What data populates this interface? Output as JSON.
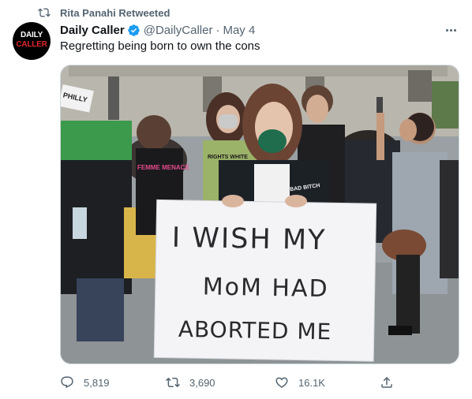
{
  "social_context": {
    "text": "Rita Panahi Retweeted",
    "icon": "retweet-icon"
  },
  "author": {
    "avatar_line1": "DAILY",
    "avatar_line2": "CALLER",
    "name": "Daily Caller",
    "handle": "@DailyCaller",
    "separator": "·",
    "date": "May 4",
    "verified_color": "#1d9bf0"
  },
  "tweet": {
    "text": "Regretting being born to own the cons"
  },
  "photo": {
    "sign_lines": [
      "I WISH MY",
      "MoM HAD",
      "ABORTED ME"
    ],
    "background_signs": [
      "PHILLY",
      "FEMME MENACE",
      "RIGHTS WHITE",
      "BAD BITCH"
    ],
    "hoodie_print": "BAD BITCH"
  },
  "actions": {
    "reply_count": "5,819",
    "retweet_count": "3,690",
    "like_count": "16.1K"
  },
  "colors": {
    "secondary_text": "#536471",
    "accent": "#1d9bf0"
  }
}
